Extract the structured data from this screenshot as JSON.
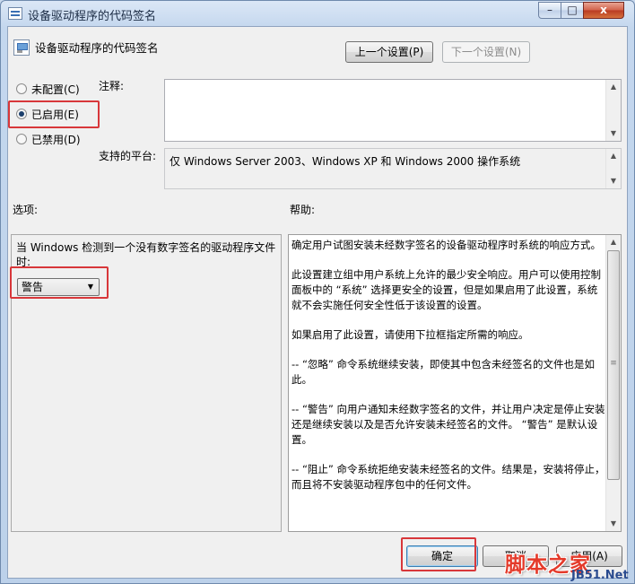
{
  "window": {
    "title": "设备驱动程序的代码签名",
    "min_glyph": "–",
    "max_glyph": "□",
    "close_glyph": "x"
  },
  "header": {
    "policy_name": "设备驱动程序的代码签名",
    "prev_button": "上一个设置(P)",
    "next_button": "下一个设置(N)"
  },
  "state": {
    "options": [
      {
        "label": "未配置(C)",
        "checked": false
      },
      {
        "label": "已启用(E)",
        "checked": true
      },
      {
        "label": "已禁用(D)",
        "checked": false
      }
    ]
  },
  "comment": {
    "label": "注释:",
    "value": ""
  },
  "platform": {
    "label": "支持的平台:",
    "value": "仅 Windows Server 2003、Windows XP 和 Windows 2000 操作系统"
  },
  "options_section": {
    "label": "选项:",
    "prompt": "当 Windows 检测到一个没有数字签名的驱动程序文件时:",
    "selected": "警告"
  },
  "help_section": {
    "label": "帮助:",
    "paragraphs": [
      "确定用户试图安装未经数字签名的设备驱动程序时系统的响应方式。",
      "此设置建立组中用户系统上允许的最少安全响应。用户可以使用控制面板中的 “系统” 选择更安全的设置，但是如果启用了此设置，系统就不会实施任何安全性低于该设置的设置。",
      "如果启用了此设置，请使用下拉框指定所需的响应。",
      "-- “忽略” 命令系统继续安装，即使其中包含未经签名的文件也是如此。",
      "-- “警告” 向用户通知未经数字签名的文件，并让用户决定是停止安装还是继续安装以及是否允许安装未经签名的文件。 “警告” 是默认设置。",
      "-- “阻止” 命令系统拒绝安装未经签名的文件。结果是，安装将停止，而且将不安装驱动程序包中的任何文件。"
    ]
  },
  "footer": {
    "ok": "确定",
    "cancel": "取消",
    "apply": "应用(A)"
  },
  "watermark": {
    "big": "脚本之家",
    "small": "JB51.Net"
  },
  "colors": {
    "highlight_box": "#d8373a",
    "close_button": "#c8462c",
    "window_frame": "#c4d7ee"
  }
}
